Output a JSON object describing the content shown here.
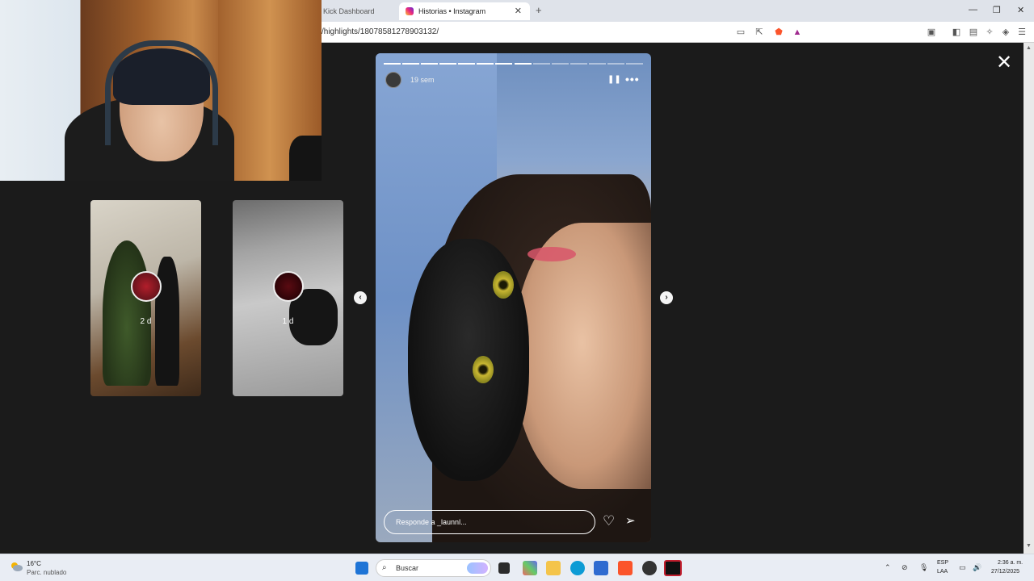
{
  "browser": {
    "tabs": [
      {
        "label": "Kick Dashboard",
        "active": false
      },
      {
        "label": "Historias • Instagram",
        "active": true
      }
    ],
    "url": "/highlights/18078581278903132/",
    "tab_close": "✕",
    "new_tab": "+",
    "window_controls": {
      "minimize": "—",
      "maximize": "❐",
      "close": "✕"
    }
  },
  "stories": {
    "side_stories": [
      {
        "time": "2 d"
      },
      {
        "time": "1 d"
      }
    ],
    "prev_label": "‹",
    "next_label": "›",
    "current": {
      "time": "19 sem",
      "pause_label": "❚❚",
      "more_label": "•••",
      "reply_placeholder": "Responde a _launnl...",
      "like_icon": "♡",
      "share_icon": "➢",
      "progress_segments_total": 14,
      "progress_segments_done": 8
    },
    "close_label": "✕"
  },
  "taskbar": {
    "weather": {
      "temp": "16°C",
      "desc": "Parc. nublado"
    },
    "search_label": "Buscar",
    "lang_line1": "ESP",
    "lang_line2": "LAA",
    "time": "2:36 a. m.",
    "date": "27/12/2025",
    "colors": {
      "start": "#1e74d6",
      "brave": "#fb542b",
      "edge": "#0c9bd5"
    }
  }
}
